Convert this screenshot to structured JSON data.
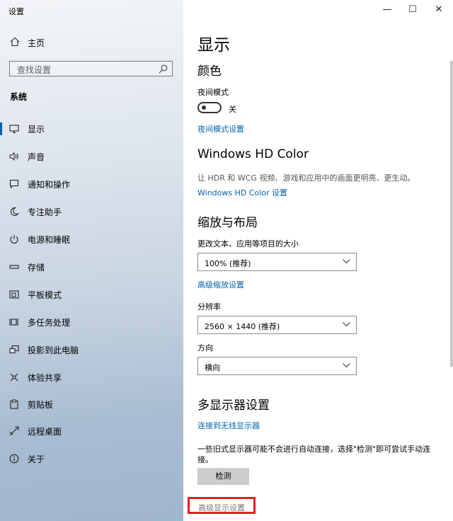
{
  "window": {
    "title": "设置",
    "controls": {
      "minimize": "—",
      "maximize": "☐",
      "close": "✕"
    }
  },
  "sidebar": {
    "home": {
      "label": "主页",
      "icon": "home-icon"
    },
    "search": {
      "placeholder": "查找设置",
      "icon": "search-icon"
    },
    "section_label": "系统",
    "items": [
      {
        "label": "显示",
        "icon": "display-icon",
        "active": true
      },
      {
        "label": "声音",
        "icon": "sound-icon"
      },
      {
        "label": "通知和操作",
        "icon": "notification-icon"
      },
      {
        "label": "专注助手",
        "icon": "moon-icon"
      },
      {
        "label": "电源和睡眠",
        "icon": "power-icon"
      },
      {
        "label": "存储",
        "icon": "storage-icon"
      },
      {
        "label": "平板模式",
        "icon": "tablet-icon"
      },
      {
        "label": "多任务处理",
        "icon": "multitask-icon"
      },
      {
        "label": "投影到此电脑",
        "icon": "project-icon"
      },
      {
        "label": "体验共享",
        "icon": "share-icon"
      },
      {
        "label": "剪贴板",
        "icon": "clipboard-icon"
      },
      {
        "label": "远程桌面",
        "icon": "remote-icon"
      },
      {
        "label": "关于",
        "icon": "info-icon"
      }
    ]
  },
  "main": {
    "title": "显示",
    "color": {
      "heading": "颜色",
      "night_mode_label": "夜间模式",
      "night_mode_state": "关",
      "night_mode_link": "夜间模式设置"
    },
    "hdr": {
      "heading": "Windows HD Color",
      "description": "让 HDR 和 WCG 视频、游戏和应用中的画面更明亮、更生动。",
      "link": "Windows HD Color 设置"
    },
    "scale": {
      "heading": "缩放与布局",
      "text_size_label": "更改文本、应用等项目的大小",
      "text_size_value": "100% (推荐)",
      "advanced_link": "高级缩放设置",
      "resolution_label": "分辨率",
      "resolution_value": "2560 × 1440 (推荐)",
      "orientation_label": "方向",
      "orientation_value": "横向"
    },
    "multi": {
      "heading": "多显示器设置",
      "wireless_link": "连接到无线显示器",
      "description_line1": "一些旧式显示器可能不会进行自动连接，选择\"检测\"即可尝试手动连",
      "description_line2": "接。",
      "detect_button": "检测",
      "advanced_display_link": "高级显示设置"
    }
  }
}
